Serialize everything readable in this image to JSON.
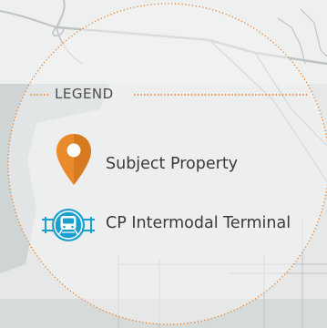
{
  "legend": {
    "title": "LEGEND",
    "items": [
      {
        "label": "Subject Property",
        "icon": "map-pin-icon"
      },
      {
        "label": "CP Intermodal Terminal",
        "icon": "train-terminal-icon"
      }
    ]
  },
  "colors": {
    "accent_orange": "#e98a2b",
    "dotted_orange": "#ea7a1e",
    "terminal_blue": "#1a9fcf",
    "map_land": "#e9ebeb",
    "map_water_band": "#c8cfce",
    "road_gray": "#b9bdbd",
    "legend_panel": "#f3f4f4"
  }
}
